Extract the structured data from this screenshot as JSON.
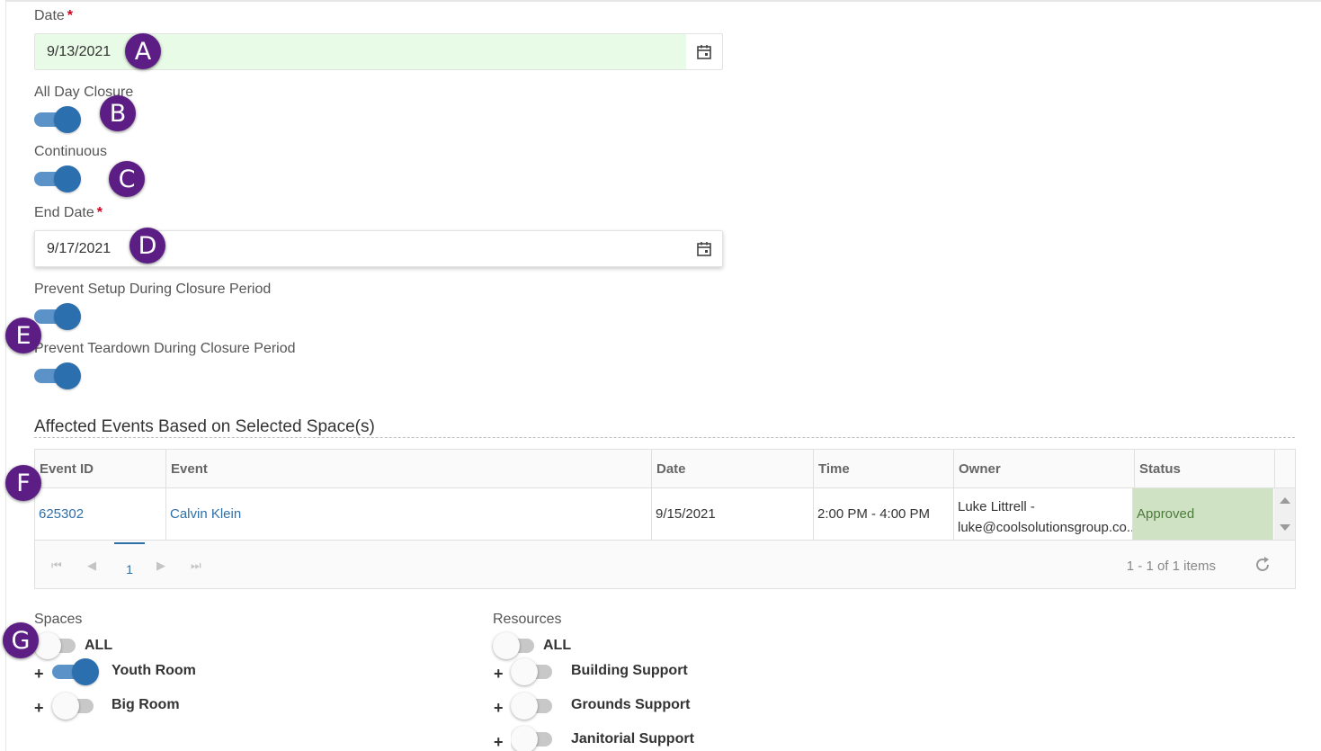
{
  "form": {
    "date_label": "Date",
    "required_mark": "*",
    "date_value": "9/13/2021",
    "all_day_label": "All Day Closure",
    "continuous_label": "Continuous",
    "end_date_label": "End Date",
    "end_date_value": "9/17/2021",
    "prevent_setup_label": "Prevent Setup During Closure Period",
    "prevent_teardown_label": "Prevent Teardown During Closure Period"
  },
  "callouts": [
    "A",
    "B",
    "C",
    "D",
    "E",
    "F",
    "G"
  ],
  "events": {
    "title": "Affected Events Based on Selected Space(s)",
    "columns": [
      "Event ID",
      "Event",
      "Date",
      "Time",
      "Owner",
      "Status"
    ],
    "rows": [
      {
        "event_id": "625302",
        "event": "Calvin Klein",
        "date": "9/15/2021",
        "time": "2:00 PM - 4:00 PM",
        "owner_name": "Luke Littrell -",
        "owner_email": "luke@coolsolutionsgroup.co...",
        "status": "Approved"
      }
    ],
    "pager": {
      "first": "⏮",
      "prev": "◀",
      "page": "1",
      "next": "▶",
      "last": "⏭",
      "info": "1 - 1 of 1 items"
    }
  },
  "spaces": {
    "label": "Spaces",
    "all_label": "ALL",
    "items": [
      {
        "name": "Youth Room",
        "on": true
      },
      {
        "name": "Big Room",
        "on": false
      }
    ]
  },
  "resources": {
    "label": "Resources",
    "all_label": "ALL",
    "items": [
      {
        "name": "Building Support",
        "on": false
      },
      {
        "name": "Grounds Support",
        "on": false
      },
      {
        "name": "Janitorial Support",
        "on": false
      }
    ]
  },
  "colors": {
    "accent": "#2c6fae",
    "callout": "#5c1e85",
    "valid_bg": "#e8fbe6",
    "status_approved_bg": "#cfe3c4"
  }
}
